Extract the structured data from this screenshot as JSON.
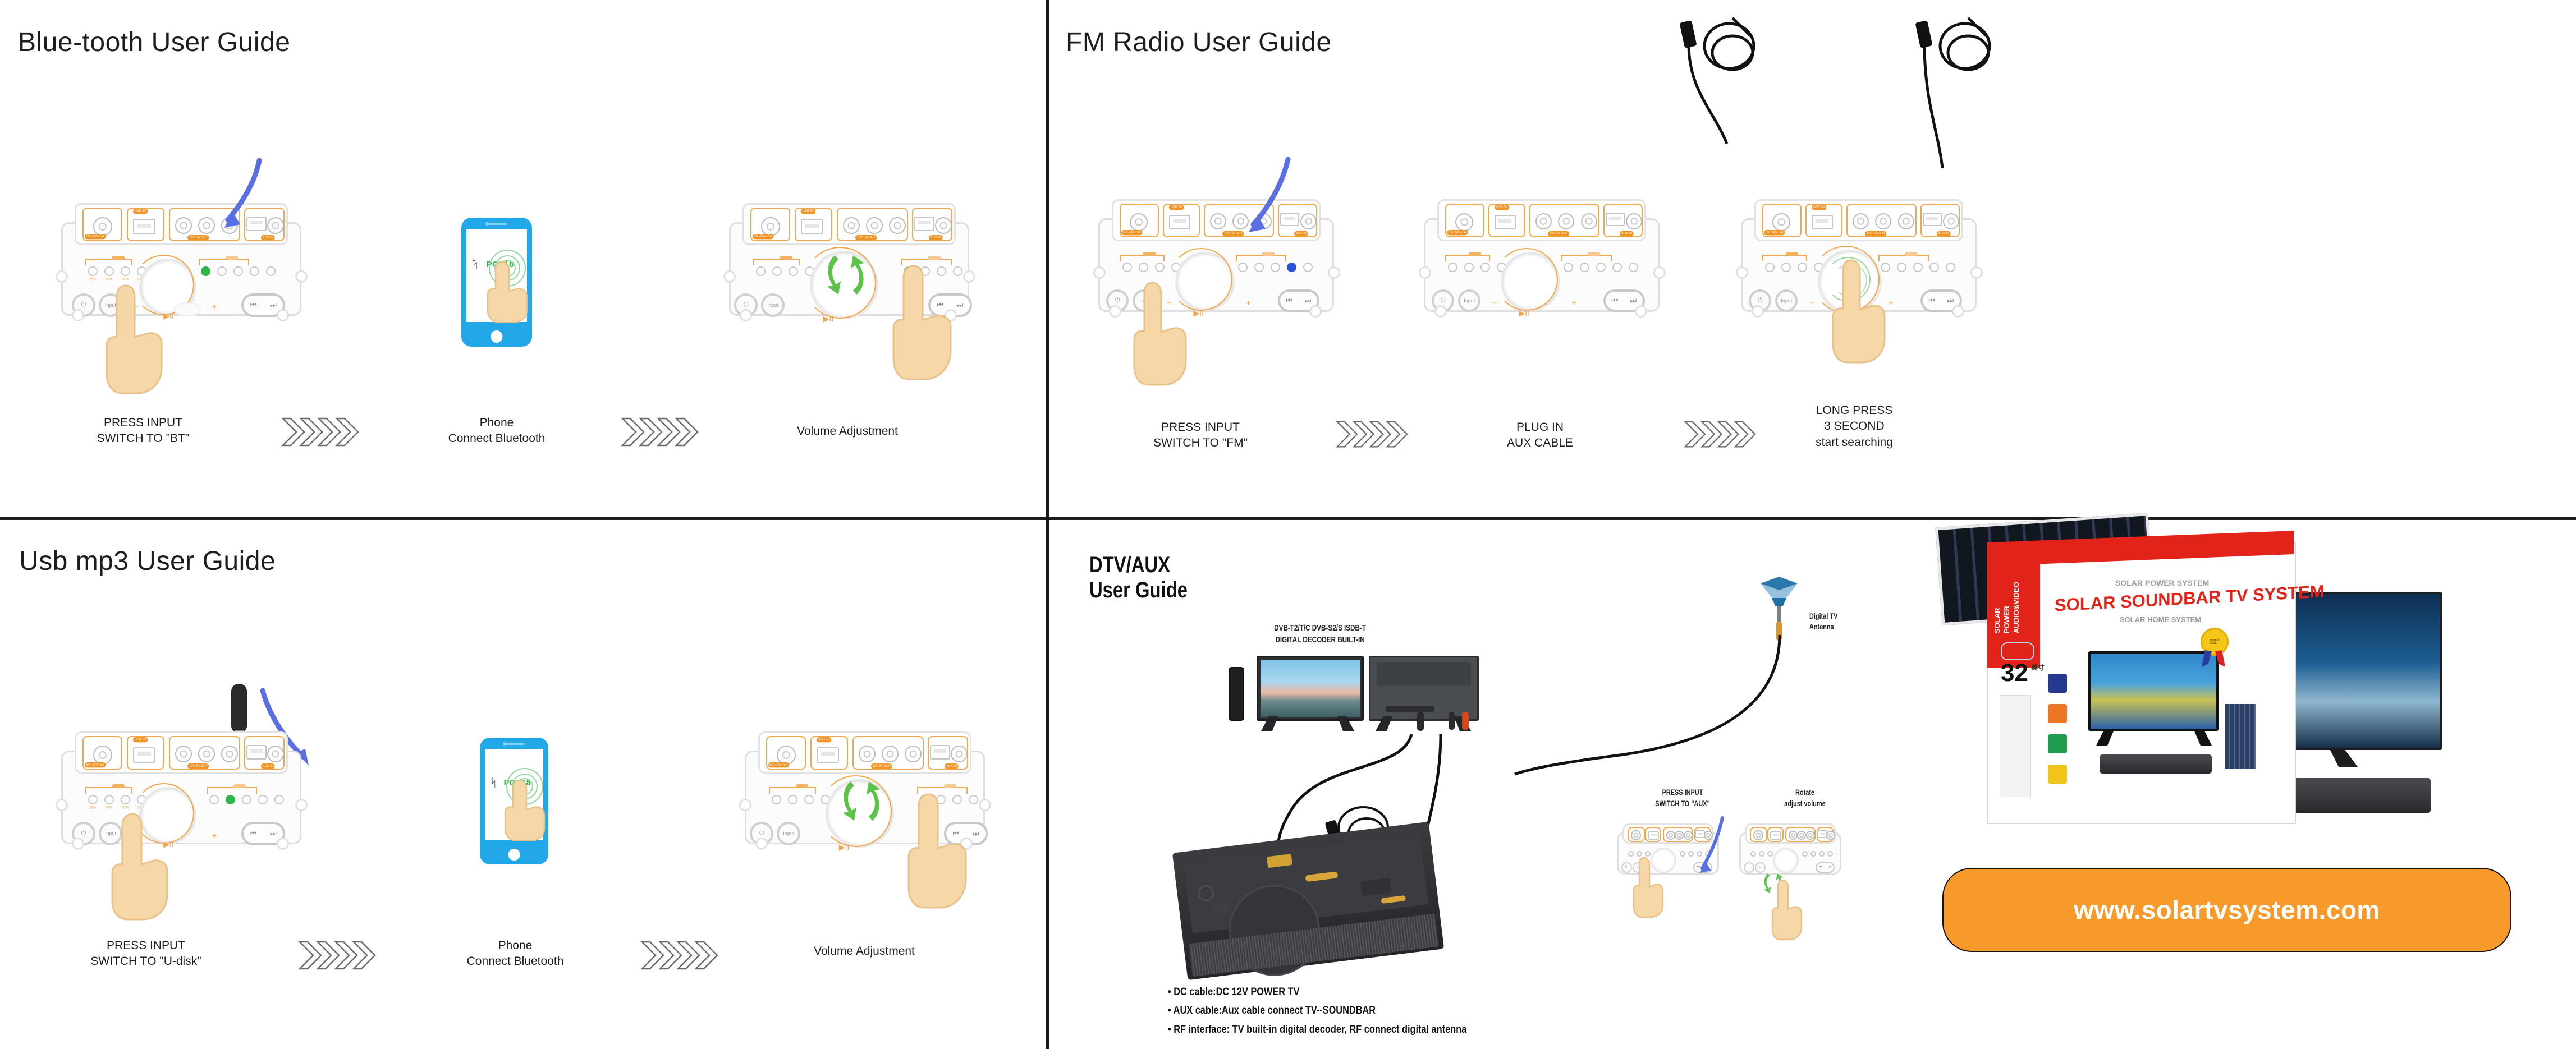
{
  "page": {
    "background": "#ffffff",
    "divider_color": "#1b1b1b",
    "accent_orange": "#f39324",
    "accent_green": "#2fb54a",
    "accent_blue": "#4a63d8",
    "brand_red": "#e2231a"
  },
  "bluetooth_guide": {
    "title": "Blue-tooth User Guide",
    "steps": [
      {
        "caption": "PRESS INPUT\nSWITCH TO \"BT\""
      },
      {
        "caption": "Phone\nConnect Bluetooth"
      },
      {
        "caption": "Volume Adjustment"
      }
    ],
    "phone": {
      "bt_name": "POV18",
      "bt_icon": "bluetooth-icon"
    },
    "panel": {
      "power_button": "power-icon",
      "input_button": "Input",
      "battery_labels": [
        "25%",
        "50%",
        "75%",
        "100%"
      ],
      "audio_group_label": "audio",
      "port_labels": [
        "5V~24V~5A",
        "USB 5V",
        "12V 5A OUT",
        "AUX IN"
      ],
      "minus": "−",
      "plus": "+",
      "play_pause": "▶II",
      "prev": "⏮",
      "next": "⏭"
    }
  },
  "fm_guide": {
    "title": "FM Radio User Guide",
    "steps": [
      {
        "caption": "PRESS INPUT\nSWITCH TO \"FM\""
      },
      {
        "caption": "PLUG IN\nAUX CABLE"
      },
      {
        "caption": "LONG PRESS\n3 SECOND\nstart searching"
      }
    ]
  },
  "usb_guide": {
    "title": "Usb mp3 User Guide",
    "steps": [
      {
        "caption": "PRESS INPUT\nSWITCH TO \"U-disk\""
      },
      {
        "caption": "Phone\nConnect Bluetooth"
      },
      {
        "caption": "Volume Adjustment"
      }
    ],
    "phone": {
      "bt_name": "POV18",
      "bt_icon": "bluetooth-icon"
    }
  },
  "dtv_guide": {
    "title": "DTV/AUX\nUser Guide",
    "tv_label": "DVB-T2/T/C  DVB-S2/S ISDB-T\nDIGITAL DECODER BUILT-IN",
    "antenna_label": "Digital TV\nAntenna",
    "mini_steps": [
      {
        "caption": "PRESS INPUT\nSWITCH TO \"AUX\""
      },
      {
        "caption": "Rotate\nadjust volume"
      }
    ],
    "bullets": [
      "• DC cable:DC 12V POWER TV",
      "• AUX cable:Aux cable connect TV--SOUNDBAR",
      "• RF interface: TV built-in digital decoder, RF connect digital antenna"
    ]
  },
  "product": {
    "box": {
      "top_line": "SOLAR POWER SYSTEM",
      "main_title": "SOLAR SOUNDBAR TV SYSTEM",
      "sub_title": "SOLAR HOME SYSTEM",
      "side_text": "SOLAR POWER\nAUDIO&VIDEO",
      "size_number": "32",
      "size_unit": "英寸",
      "medal_text": "32\"",
      "feature_icons": [
        "solar-panel-icon",
        "power-icon",
        "bluetooth-icon",
        "battery-icon"
      ]
    }
  },
  "footer": {
    "website": "www.solartvsystem.com",
    "website_bg": "#f79a2b"
  }
}
